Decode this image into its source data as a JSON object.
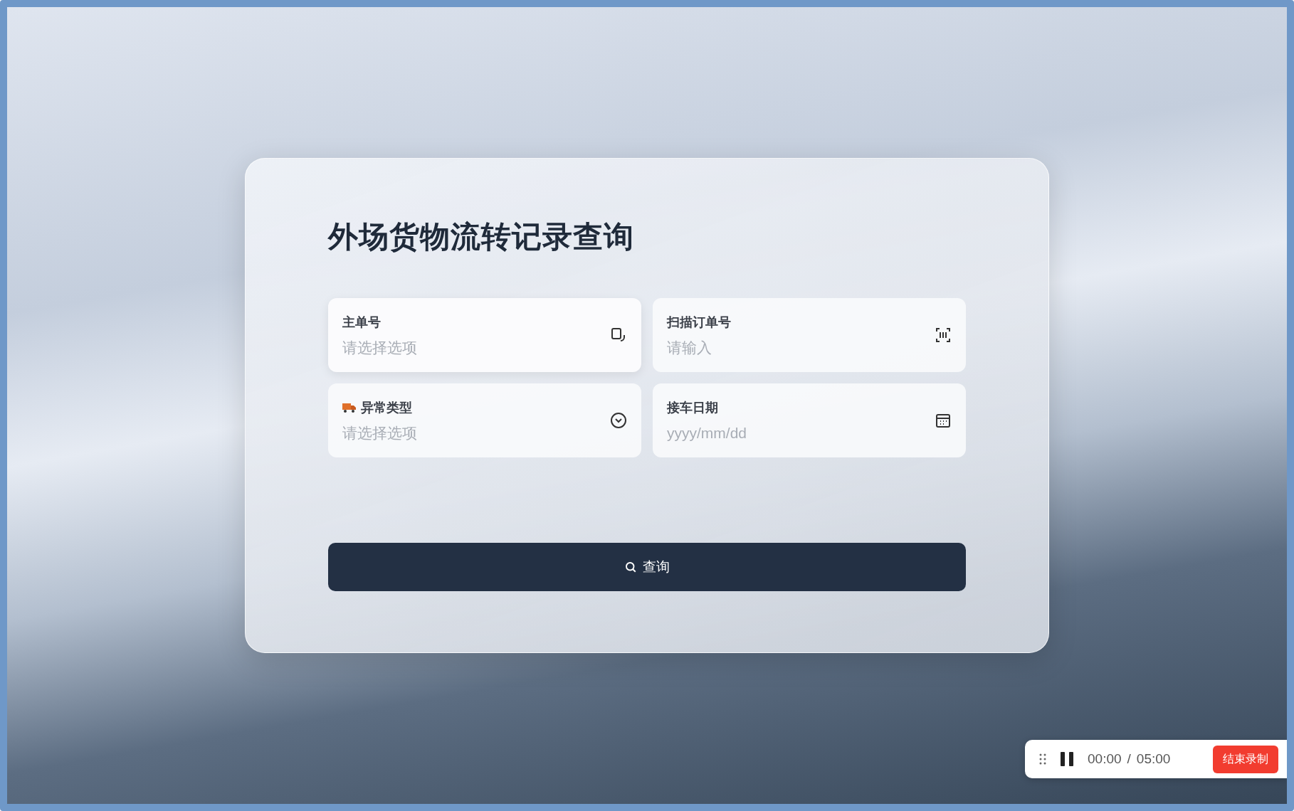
{
  "form": {
    "title": "外场货物流转记录查询",
    "fields": [
      {
        "label": "主单号",
        "placeholder": "请选择选项",
        "kind": "select",
        "focused": true
      },
      {
        "label": "扫描订单号",
        "placeholder": "请输入",
        "kind": "scan",
        "focused": false
      },
      {
        "label": "异常类型",
        "placeholder": "请选择选项",
        "kind": "dropdown",
        "focused": false
      },
      {
        "label": "接车日期",
        "placeholder": "yyyy/mm/dd",
        "kind": "date",
        "focused": false
      }
    ],
    "submit": "查询"
  },
  "recorder": {
    "elapsed": "00:00",
    "separator": "/",
    "limit": "05:00",
    "stop": "结束录制"
  }
}
